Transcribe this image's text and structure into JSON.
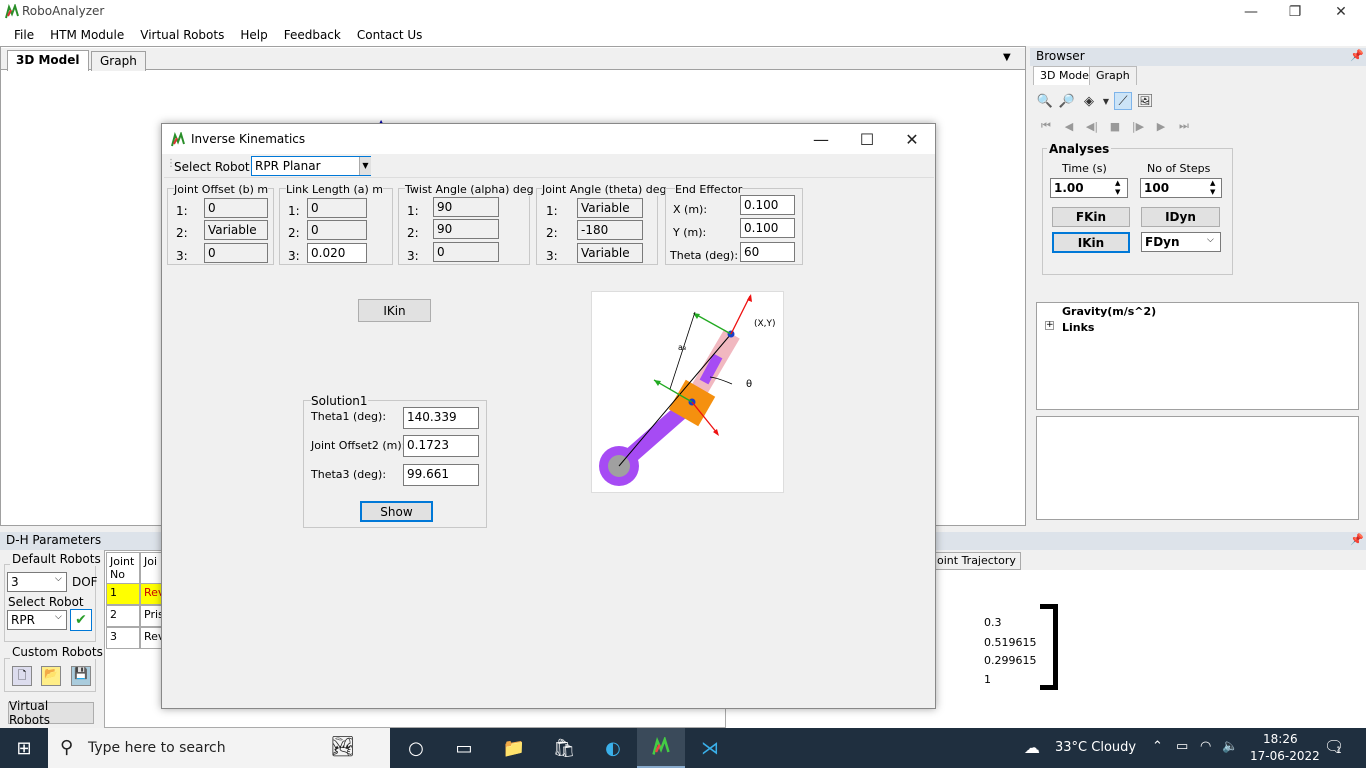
{
  "app": {
    "title": "RoboAnalyzer"
  },
  "window_controls": {
    "minimize": "—",
    "restore": "❐",
    "close": "✕"
  },
  "menu": [
    "File",
    "HTM Module",
    "Virtual Robots",
    "Help",
    "Feedback",
    "Contact Us"
  ],
  "main_tabs": [
    {
      "label": "3D Model",
      "active": true
    },
    {
      "label": "Graph",
      "active": false
    }
  ],
  "browser": {
    "title": "Browser",
    "tabs": [
      "3D Model",
      "Graph"
    ],
    "analyses": {
      "title": "Analyses",
      "time_label": "Time (s)",
      "time_value": "1.00",
      "steps_label": "No of Steps",
      "steps_value": "100",
      "fkin": "FKin",
      "idyn": "IDyn",
      "ikin": "IKin",
      "fdyn": "FDyn"
    },
    "tree": {
      "gravity": "Gravity(m/s^2)",
      "links": "Links",
      "expand": "+"
    }
  },
  "dh": {
    "title": "D-H Parameters",
    "default_robots_label": "Default Robots",
    "dof_value": "3",
    "dof_label": "DOF",
    "select_robot_label": "Select Robot",
    "robot_value": "RPR",
    "custom_robots_label": "Custom Robots",
    "virtual_robots": "Virtual Robots",
    "table_headers": [
      "Joint No",
      "Joi"
    ],
    "rows": [
      {
        "no": "1",
        "type": "Rev"
      },
      {
        "no": "2",
        "type": "Pris"
      },
      {
        "no": "3",
        "type": "Rev"
      }
    ]
  },
  "trajectory_tab": "oint Trajectory",
  "matrix_values": [
    "0.3",
    "0.519615",
    "0.299615",
    "1"
  ],
  "dialog": {
    "title": "Inverse Kinematics",
    "select_robot_label": "Select Robot:",
    "select_robot_value": "RPR Planar",
    "columns": {
      "offset": {
        "header": "Joint Offset (b) m",
        "values": [
          "0",
          "Variable",
          "0"
        ]
      },
      "length": {
        "header": "Link Length (a) m",
        "values": [
          "0",
          "0",
          "0.020"
        ]
      },
      "twist": {
        "header": "Twist Angle (alpha) deg",
        "values": [
          "90",
          "90",
          "0"
        ]
      },
      "theta": {
        "header": "Joint Angle (theta) deg",
        "values": [
          "Variable",
          "-180",
          "Variable"
        ]
      }
    },
    "row_labels": [
      "1:",
      "2:",
      "3:"
    ],
    "end_effector": {
      "header": "End Effector",
      "x_label": "X (m):",
      "x_value": "0.100",
      "y_label": "Y (m):",
      "y_value": "0.100",
      "theta_label": "Theta (deg):",
      "theta_value": "60"
    },
    "ikin_button": "IKin",
    "solution": {
      "title": "Solution1",
      "theta1_label": "Theta1 (deg):",
      "theta1_value": "140.339",
      "offset2_label": "Joint Offset2 (m):",
      "offset2_value": "0.1723",
      "theta3_label": "Theta3 (deg):",
      "theta3_value": "99.661",
      "show_button": "Show"
    },
    "diagram": {
      "xy_label": "(X,Y)",
      "theta_label": "θ",
      "a3_label": "a₃"
    }
  },
  "taskbar": {
    "search_placeholder": "Type here to search",
    "weather": "33°C  Cloudy",
    "time": "18:26",
    "date": "17-06-2022",
    "notifications": "1"
  }
}
